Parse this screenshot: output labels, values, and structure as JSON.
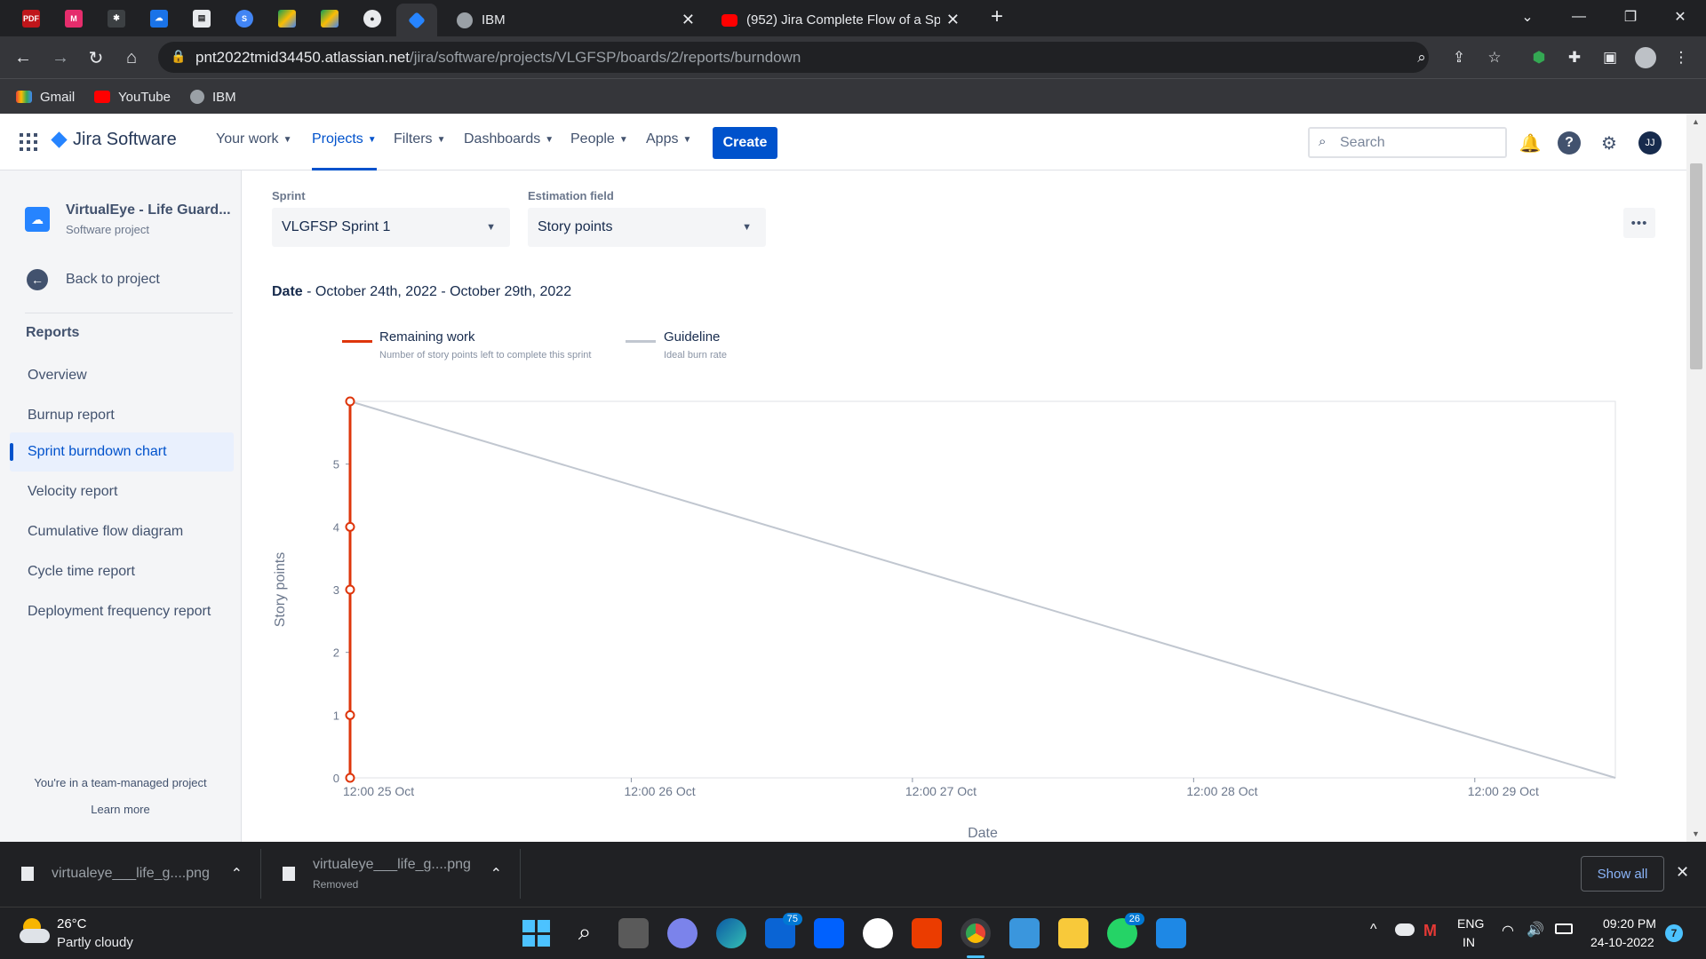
{
  "browser": {
    "tabs": [
      {
        "title": "IBM",
        "active": false
      },
      {
        "title": "(952) Jira Complete Flow of a Spr",
        "active": false
      }
    ],
    "pinned_icons": [
      "pdf-icon",
      "m-icon",
      "app-icon",
      "cloud-icon",
      "doc-icon",
      "s-icon",
      "drive-icon",
      "drive-icon-2",
      "github-icon",
      "jira-icon"
    ],
    "url_host": "pnt2022tmid34450.atlassian.net",
    "url_path": "/jira/software/projects/VLGFSP/boards/2/reports/burndown",
    "bookmarks": [
      "Gmail",
      "YouTube",
      "IBM"
    ]
  },
  "jira": {
    "product": "Jira Software",
    "nav": [
      "Your work",
      "Projects",
      "Filters",
      "Dashboards",
      "People",
      "Apps"
    ],
    "create_label": "Create",
    "search_placeholder": "Search",
    "avatar": "JJ"
  },
  "sidebar": {
    "project_name": "VirtualEye - Life Guard...",
    "project_type": "Software project",
    "back_label": "Back to project",
    "section": "Reports",
    "items": [
      "Overview",
      "Burnup report",
      "Sprint burndown chart",
      "Velocity report",
      "Cumulative flow diagram",
      "Cycle time report",
      "Deployment frequency report"
    ],
    "active_index": 2,
    "footer": "You're in a team-managed project",
    "learn_more": "Learn more"
  },
  "report": {
    "sprint_label": "Sprint",
    "sprint_value": "VLGFSP Sprint 1",
    "estimation_label": "Estimation field",
    "estimation_value": "Story points",
    "date_label": "Date",
    "date_value": " - October 24th, 2022 - October 29th, 2022",
    "more_label": "•••"
  },
  "chart_data": {
    "type": "line",
    "xlabel": "Date",
    "ylabel": "Story points",
    "x_ticks": [
      "12:00 25 Oct",
      "12:00 26 Oct",
      "12:00 27 Oct",
      "12:00 28 Oct",
      "12:00 29 Oct"
    ],
    "y_ticks": [
      0,
      1,
      2,
      3,
      4,
      5
    ],
    "ylim": [
      0,
      6
    ],
    "xlim_days": [
      0,
      4.5
    ],
    "legend": [
      {
        "name": "Remaining work",
        "desc": "Number of story points left to complete this sprint",
        "color": "#de350b"
      },
      {
        "name": "Guideline",
        "desc": "Ideal burn rate",
        "color": "#c1c7d0"
      }
    ],
    "series": [
      {
        "name": "Remaining work",
        "points": [
          [
            0,
            0
          ],
          [
            0,
            1
          ],
          [
            0,
            3
          ],
          [
            0,
            4
          ],
          [
            0,
            6
          ]
        ]
      },
      {
        "name": "Guideline",
        "points": [
          [
            0,
            6
          ],
          [
            4.5,
            0
          ]
        ]
      }
    ]
  },
  "downloads": [
    {
      "name": "virtualeye___life_g....png",
      "status": ""
    },
    {
      "name": "virtualeye___life_g....png",
      "status": "Removed"
    }
  ],
  "downloads_show_all": "Show all",
  "taskbar": {
    "weather_temp": "26°C",
    "weather_desc": "Partly cloudy",
    "lang1": "ENG",
    "lang2": "IN",
    "time": "09:20 PM",
    "date": "24-10-2022",
    "notif": "7",
    "badge_mail": "75",
    "badge_whatsapp": "26"
  }
}
